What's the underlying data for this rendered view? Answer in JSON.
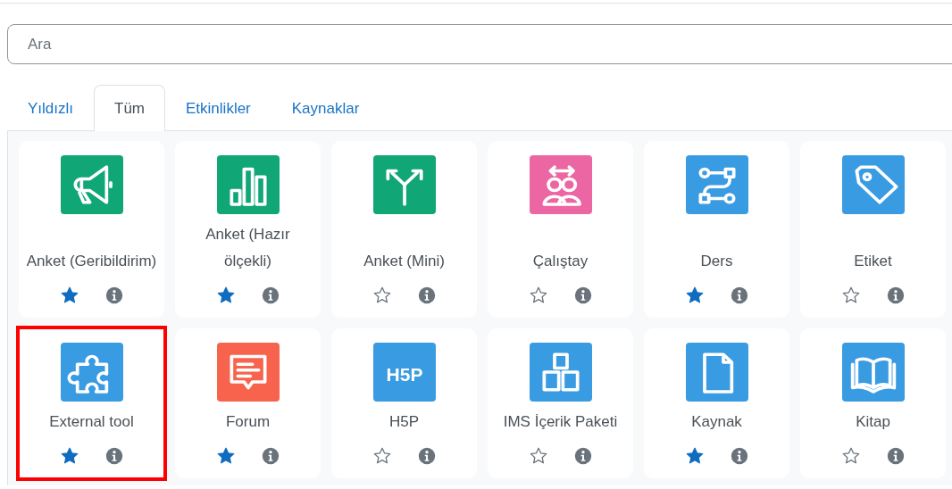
{
  "search": {
    "placeholder": "Ara"
  },
  "tabs": [
    {
      "label": "Yıldızlı",
      "selected": false
    },
    {
      "label": "Tüm",
      "selected": true
    },
    {
      "label": "Etkinlikler",
      "selected": false
    },
    {
      "label": "Kaynaklar",
      "selected": false
    }
  ],
  "modules": [
    {
      "label": "Anket (Geribildirim)",
      "kind": "megaphone",
      "color": "#11a676",
      "starred": true,
      "highlighted": false
    },
    {
      "label": "Anket (Hazır ölçekli)",
      "kind": "bars",
      "color": "#11a676",
      "starred": true,
      "highlighted": false
    },
    {
      "label": "Anket (Mini)",
      "kind": "fork",
      "color": "#11a676",
      "starred": false,
      "highlighted": false
    },
    {
      "label": "Çalıştay",
      "kind": "people",
      "color": "#eb66a2",
      "starred": false,
      "highlighted": false
    },
    {
      "label": "Ders",
      "kind": "path",
      "color": "#399be2",
      "starred": true,
      "highlighted": false
    },
    {
      "label": "Etiket",
      "kind": "tag",
      "color": "#399be2",
      "starred": false,
      "highlighted": false
    },
    {
      "label": "External tool",
      "kind": "puzzle",
      "color": "#399be2",
      "starred": true,
      "highlighted": true
    },
    {
      "label": "Forum",
      "kind": "chat",
      "color": "#f7634d",
      "starred": true,
      "highlighted": false
    },
    {
      "label": "H5P",
      "kind": "logo",
      "logo_text": "H5P",
      "color": "#399be2",
      "starred": false,
      "highlighted": false
    },
    {
      "label": "IMS İçerik Paketi",
      "kind": "boxes",
      "color": "#399be2",
      "starred": false,
      "highlighted": false
    },
    {
      "label": "Kaynak",
      "kind": "file",
      "color": "#399be2",
      "starred": true,
      "highlighted": false
    },
    {
      "label": "Kitap",
      "kind": "book",
      "color": "#399be2",
      "starred": false,
      "highlighted": false
    }
  ]
}
